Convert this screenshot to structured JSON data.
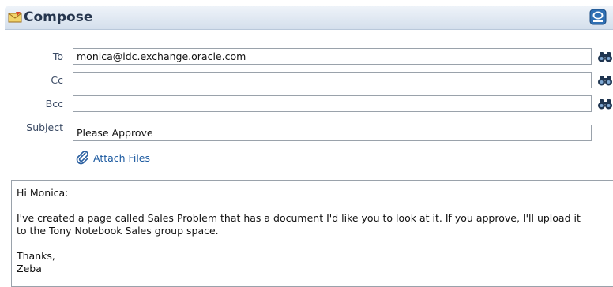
{
  "header": {
    "title": "Compose",
    "compose_icon": "compose-envelope-icon",
    "maximize_icon": "maximize-icon"
  },
  "fields": {
    "to": {
      "label": "To",
      "value": "monica@idc.exchange.oracle.com"
    },
    "cc": {
      "label": "Cc",
      "value": ""
    },
    "bcc": {
      "label": "Bcc",
      "value": ""
    },
    "subject": {
      "label": "Subject",
      "value": "Please Approve"
    }
  },
  "attach": {
    "label": "Attach Files",
    "icon": "paperclip-icon"
  },
  "message": {
    "lines": [
      "Hi Monica:",
      "",
      "I've created a page called Sales Problem that has a document I'd like you to look at it.  If you approve, I'll upload it",
      "to the Tony Notebook Sales group space.",
      "",
      "Thanks,",
      "Zeba"
    ]
  },
  "colors": {
    "header_gradient_top": "#eef3f9",
    "header_gradient_bottom": "#d4dfec",
    "label": "#3a4a64",
    "link": "#1c5aa0",
    "border": "#9aa2ab"
  }
}
